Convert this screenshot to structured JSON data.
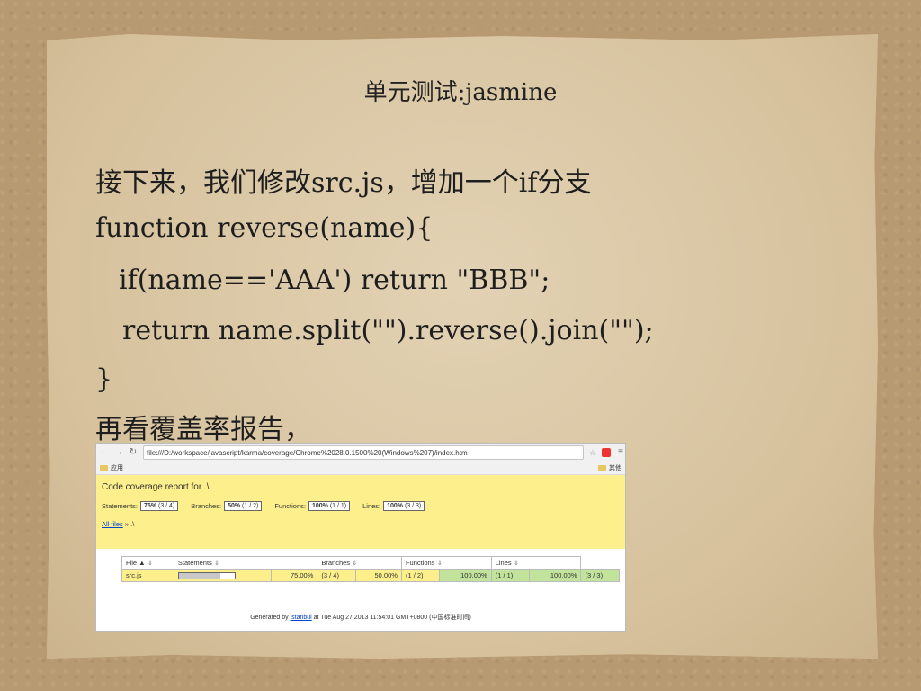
{
  "slide": {
    "title": "单元测试:jasmine",
    "line1": "接下来，我们修改src.js，增加一个if分支",
    "line2": "function reverse(name){",
    "line3": "if(name=='AAA') return \"BBB\";",
    "line4": "return name.split(\"\").reverse().join(\"\");",
    "line5": "}",
    "line6": "再看覆盖率报告，"
  },
  "browser": {
    "url": "file:///D:/workspace/javascript/karma/coverage/Chrome%2028.0.1500%20(Windows%207)/index.htm",
    "bookmark_left": "应用",
    "bookmark_right": "其他"
  },
  "report": {
    "title": "Code coverage report for .\\",
    "stats": [
      {
        "label": "Statements:",
        "pct": "75%",
        "count": "(3 / 4)"
      },
      {
        "label": "Branches:",
        "pct": "50%",
        "count": "(1 / 2)"
      },
      {
        "label": "Functions:",
        "pct": "100%",
        "count": "(1 / 1)"
      },
      {
        "label": "Lines:",
        "pct": "100%",
        "count": "(3 / 3)"
      }
    ],
    "crumb_link": "All files",
    "crumb_rest": " » .\\",
    "headers": {
      "file": "File ▲",
      "statements": "Statements",
      "branches": "Branches",
      "functions": "Functions",
      "lines": "Lines"
    },
    "row": {
      "file": "src.js",
      "stmt_pct": "75.00%",
      "stmt_count": "(3 / 4)",
      "branch_pct": "50.00%",
      "branch_count": "(1 / 2)",
      "func_pct": "100.00%",
      "func_count": "(1 / 1)",
      "lines_pct": "100.00%",
      "lines_count": "(3 / 3)",
      "coverage_fraction": 0.75
    },
    "footer_prefix": "Generated by ",
    "footer_link": "istanbul",
    "footer_suffix": " at Tue Aug 27 2013 11:54:01 GMT+0800 (中国标准时间)"
  },
  "colors": {
    "report_bg": "#fdf08c",
    "covered_green": "#c2e39b",
    "paper": "#d8c5a3",
    "link": "#0044cc"
  }
}
